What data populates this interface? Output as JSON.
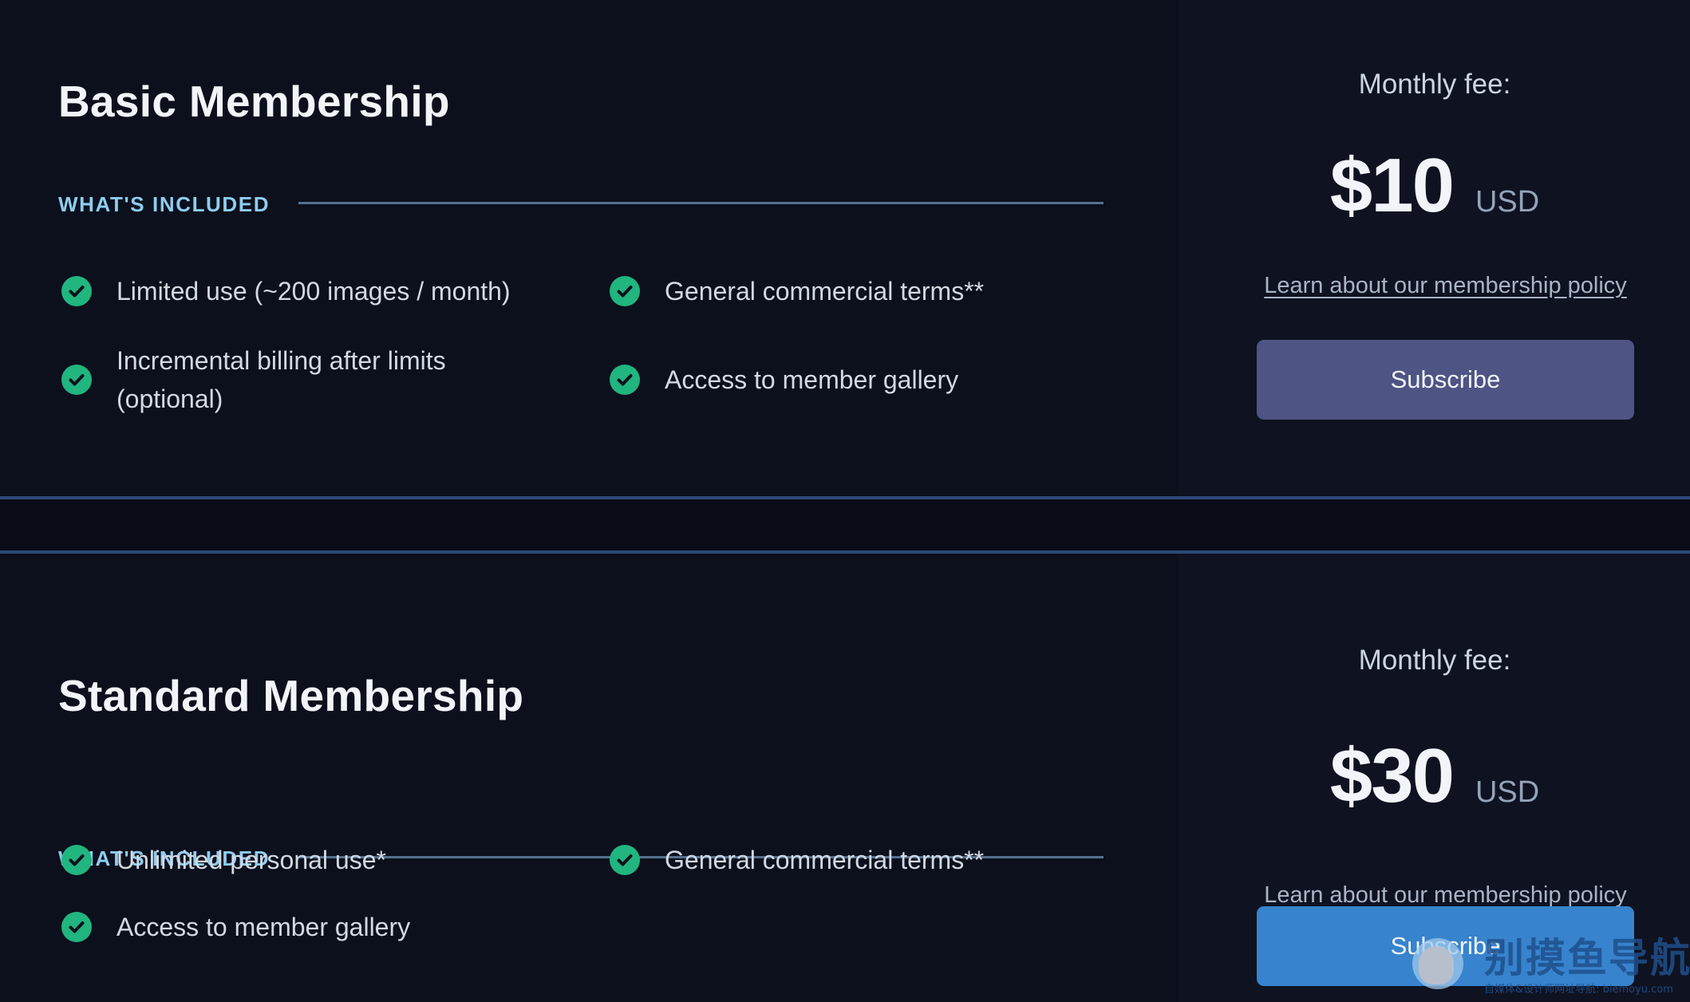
{
  "plans": [
    {
      "title": "Basic Membership",
      "included_label": "WHAT'S INCLUDED",
      "features": [
        "Limited use (~200 images / month)",
        "General commercial terms**",
        "Incremental billing after limits (optional)",
        "Access to member gallery"
      ],
      "fee_label": "Monthly fee:",
      "price": "$10",
      "currency": "USD",
      "policy_link": "Learn about our membership policy",
      "button_label": "Subscribe",
      "button_color": "#4e5484"
    },
    {
      "title": "Standard Membership",
      "included_label": "WHAT'S INCLUDED",
      "features": [
        "Unlimited personal use*",
        "General commercial terms**",
        "Access to member gallery"
      ],
      "fee_label": "Monthly fee:",
      "price": "$30",
      "currency": "USD",
      "policy_link": "Learn about our membership policy",
      "button_label": "Subscribe",
      "button_color": "#3783cd"
    }
  ],
  "colors": {
    "background": "#0c101c",
    "accent_label": "#8ecdf0",
    "check": "#21b57f",
    "divider": "#2c4878"
  },
  "watermark": {
    "title": "别摸鱼导航",
    "subtitle": "自媒体&设计师网址导航: biemoyu.com"
  }
}
